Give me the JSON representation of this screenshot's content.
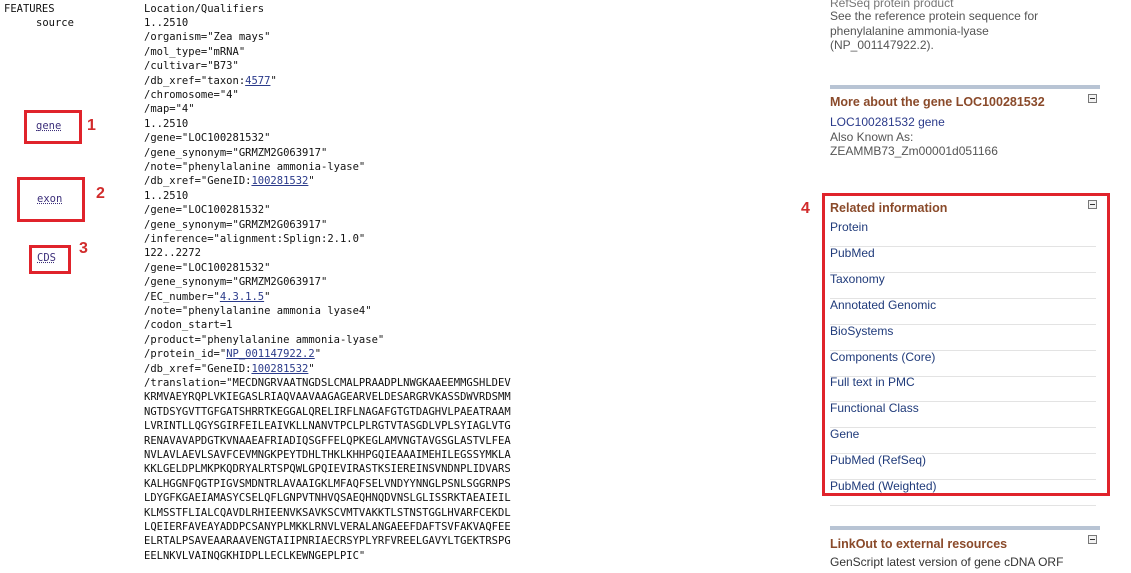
{
  "features": {
    "col1_header": "FEATURES",
    "col2_header": "Location/Qualifiers",
    "source_label": "source",
    "gene_link": "gene",
    "exon_link": "exon",
    "cds_link": "CDS",
    "lines": [
      {
        "pre": "1..2510",
        "link": "",
        "post": ""
      },
      {
        "pre": "/organism=\"Zea mays\"",
        "link": "",
        "post": ""
      },
      {
        "pre": "/mol_type=\"mRNA\"",
        "link": "",
        "post": ""
      },
      {
        "pre": "/cultivar=\"B73\"",
        "link": "",
        "post": ""
      },
      {
        "pre": "/db_xref=\"taxon:",
        "link": "4577",
        "post": "\""
      },
      {
        "pre": "/chromosome=\"4\"",
        "link": "",
        "post": ""
      },
      {
        "pre": "/map=\"4\"",
        "link": "",
        "post": ""
      },
      {
        "pre": "1..2510",
        "link": "",
        "post": ""
      },
      {
        "pre": "/gene=\"LOC100281532\"",
        "link": "",
        "post": ""
      },
      {
        "pre": "/gene_synonym=\"GRMZM2G063917\"",
        "link": "",
        "post": ""
      },
      {
        "pre": "/note=\"phenylalanine ammonia-lyase\"",
        "link": "",
        "post": ""
      },
      {
        "pre": "/db_xref=\"GeneID:",
        "link": "100281532",
        "post": "\""
      },
      {
        "pre": "1..2510",
        "link": "",
        "post": ""
      },
      {
        "pre": "/gene=\"LOC100281532\"",
        "link": "",
        "post": ""
      },
      {
        "pre": "/gene_synonym=\"GRMZM2G063917\"",
        "link": "",
        "post": ""
      },
      {
        "pre": "/inference=\"alignment:Splign:2.1.0\"",
        "link": "",
        "post": ""
      },
      {
        "pre": "122..2272",
        "link": "",
        "post": ""
      },
      {
        "pre": "/gene=\"LOC100281532\"",
        "link": "",
        "post": ""
      },
      {
        "pre": "/gene_synonym=\"GRMZM2G063917\"",
        "link": "",
        "post": ""
      },
      {
        "pre": "/EC_number=\"",
        "link": "4.3.1.5",
        "post": "\""
      },
      {
        "pre": "/note=\"phenylalanine ammonia lyase4\"",
        "link": "",
        "post": ""
      },
      {
        "pre": "/codon_start=1",
        "link": "",
        "post": ""
      },
      {
        "pre": "/product=\"phenylalanine ammonia-lyase\"",
        "link": "",
        "post": ""
      },
      {
        "pre": "/protein_id=\"",
        "link": "NP_001147922.2",
        "post": "\""
      },
      {
        "pre": "/db_xref=\"GeneID:",
        "link": "100281532",
        "post": "\""
      },
      {
        "pre": "/translation=\"MECDNGRVAATNGDSLCMALPRAADPLNWGKAAEEMMGSHLDEV",
        "link": "",
        "post": ""
      },
      {
        "pre": "KRMVAEYRQPLVKIEGASLRIAQVAAVAAGAGEARVELDESARGRVKASSDWVRDSMM",
        "link": "",
        "post": ""
      },
      {
        "pre": "NGTDSYGVTTGFGATSHRRTKEGGALQRELIRFLNAGAFGTGTDAGHVLPAEATRAAM",
        "link": "",
        "post": ""
      },
      {
        "pre": "LVRINTLLQGYSGIRFEILEAIVKLLNANVTPCLPLRGTVTASGDLVPLSYIAGLVTG",
        "link": "",
        "post": ""
      },
      {
        "pre": "RENAVAVAPDGTKVNAAEAFRIADIQSGFFELQPKEGLAMVNGTAVGSGLASTVLFEA",
        "link": "",
        "post": ""
      },
      {
        "pre": "NVLAVLAEVLSAVFCEVMNGKPEYTDHLTHKLKHHPGQIEAAAIMEHILEGSSYMKLA",
        "link": "",
        "post": ""
      },
      {
        "pre": "KKLGELDPLMKPKQDRYALRTSPQWLGPQIEVIRASTKSIEREINSVNDNPLIDVARS",
        "link": "",
        "post": ""
      },
      {
        "pre": "KALHGGNFQGTPIGVSMDNTRLAVAAIGKLMFAQFSELVNDYYNNGLPSNLSGGRNPS",
        "link": "",
        "post": ""
      },
      {
        "pre": "LDYGFKGAEIAMASYCSELQFLGNPVTNHVQSAEQHNQDVNSLGLISSRKTAEAIEIL",
        "link": "",
        "post": ""
      },
      {
        "pre": "KLMSSTFLIALCQAVDLRHIEENVKSAVKSCVMTVAKKTLSTNSTGGLHVARFCEKDL",
        "link": "",
        "post": ""
      },
      {
        "pre": "LQEIERFAVEAYADDPCSANYPLMKKLRNVLVERALANGAEEFDAFTSVFAKVAQFEE",
        "link": "",
        "post": ""
      },
      {
        "pre": "ELRTALPSAVEAARAAVENGTAIIPNRIAECRSYPLYRFVREELGAVYLTGEKTRSPG",
        "link": "",
        "post": ""
      },
      {
        "pre": "EELNKVLVAINQGKHIDPLLECLKEWNGEPLPIC\"",
        "link": "",
        "post": ""
      }
    ]
  },
  "annotations": {
    "n1": "1",
    "n2": "2",
    "n3": "3",
    "n4": "4"
  },
  "right": {
    "top_line1": "RefSeq protein product",
    "top_line2": "See the reference protein sequence for",
    "top_line3": "phenylalanine ammonia-lyase",
    "top_line4": "(NP_001147922.2).",
    "more_title": "More about the gene LOC100281532",
    "more_link": "LOC100281532 gene",
    "aka_label": "Also Known As:",
    "aka_value": "ZEAMMB73_Zm00001d051166",
    "related_title": "Related information",
    "related_items": [
      "Protein",
      "PubMed",
      "Taxonomy",
      "Annotated Genomic",
      "BioSystems",
      "Components (Core)",
      "Full text in PMC",
      "Functional Class",
      "Gene",
      "PubMed (RefSeq)",
      "PubMed (Weighted)"
    ],
    "linkout_title": "LinkOut to external resources",
    "linkout_item": "GenScript latest version of gene cDNA ORF"
  },
  "colors": {
    "annotation_red": "#e0232b",
    "section_title": "#8a4a2a",
    "link": "#2a3a8a"
  }
}
